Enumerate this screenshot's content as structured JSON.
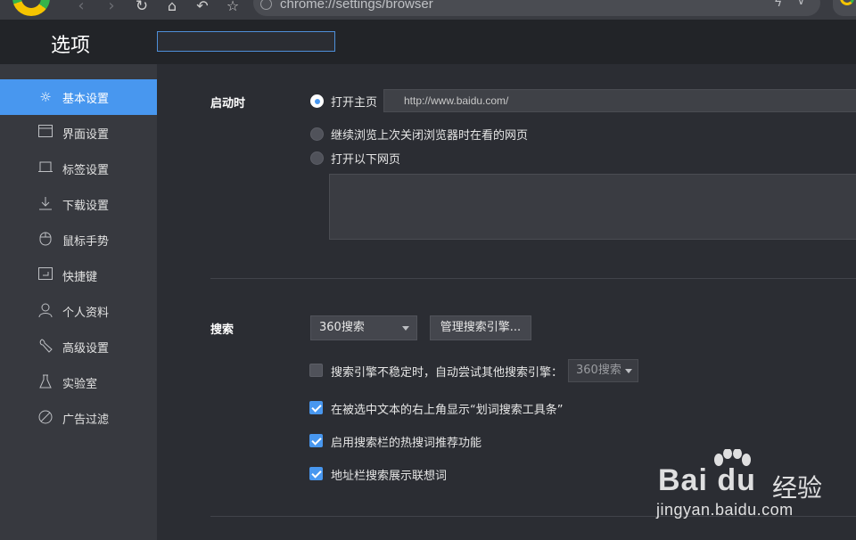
{
  "browser": {
    "address": "chrome://settings/browser",
    "nav": {
      "back_icon": "back-arrow-icon",
      "forward_icon": "forward-arrow-icon",
      "reload_icon": "reload-icon",
      "home_icon": "home-icon",
      "undo_icon": "undo-icon",
      "star_icon": "star-icon"
    }
  },
  "header": {
    "title": "选项",
    "search_value": ""
  },
  "sidebar": {
    "items": [
      {
        "label": "基本设置",
        "icon": "gear-icon",
        "active": true
      },
      {
        "label": "界面设置",
        "icon": "window-icon"
      },
      {
        "label": "标签设置",
        "icon": "tab-icon"
      },
      {
        "label": "下载设置",
        "icon": "download-icon"
      },
      {
        "label": "鼠标手势",
        "icon": "mouse-icon"
      },
      {
        "label": "快捷键",
        "icon": "keyboard-icon"
      },
      {
        "label": "个人资料",
        "icon": "user-icon"
      },
      {
        "label": "高级设置",
        "icon": "wrench-icon"
      },
      {
        "label": "实验室",
        "icon": "flask-icon"
      },
      {
        "label": "广告过滤",
        "icon": "block-icon"
      }
    ]
  },
  "startup": {
    "label": "启动时",
    "options": [
      {
        "label": "打开主页",
        "selected": true
      },
      {
        "label": "继续浏览上次关闭浏览器时在看的网页",
        "selected": false
      },
      {
        "label": "打开以下网页",
        "selected": false
      }
    ],
    "homepage_url": "http://www.baidu.com/"
  },
  "search": {
    "label": "搜索",
    "engine_selected": "360搜索",
    "manage_button": "管理搜索引擎...",
    "fallback_label": "搜索引擎不稳定时，自动尝试其他搜索引擎：",
    "fallback_engine": "360搜索",
    "checkboxes": [
      {
        "label": "搜索引擎不稳定时，自动尝试其他搜索引擎：",
        "checked": false
      },
      {
        "label": "在被选中文本的右上角显示“划词搜索工具条”",
        "checked": true
      },
      {
        "label": "启用搜索栏的热搜词推荐功能",
        "checked": true
      },
      {
        "label": "地址栏搜索展示联想词",
        "checked": true
      }
    ]
  },
  "watermark": {
    "brand": "Bai du",
    "brand_cn": "经验",
    "url": "jingyan.baidu.com"
  },
  "colors": {
    "accent": "#4897ef",
    "sidebar_bg": "#37393f",
    "main_bg": "#2b2d33",
    "header_bg": "#222428"
  }
}
